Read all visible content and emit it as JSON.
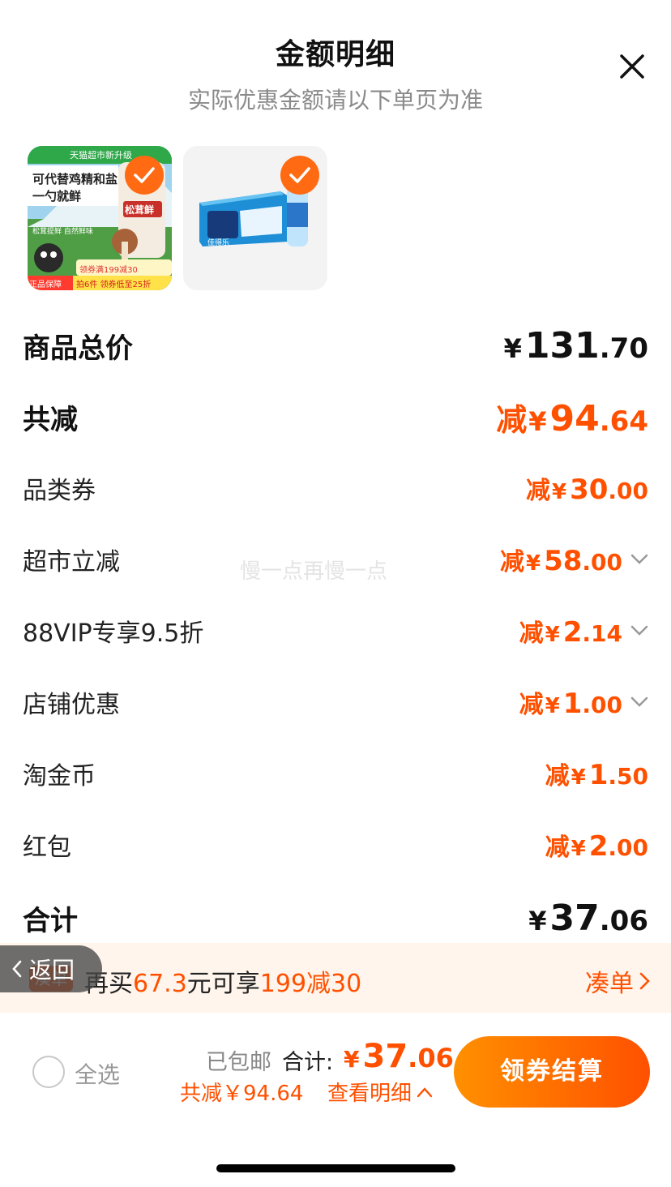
{
  "header": {
    "title": "金额明细",
    "subtitle": "实际优惠金额请以下单页为准"
  },
  "products": [
    {
      "banner": "天猫超市新升级",
      "headline": "可代替鸡精和盐",
      "subline": "一勺就鲜",
      "tagline": "松茸提鲜 自然鲜味",
      "brand": "松茸鲜",
      "coupon": "领券满199减30",
      "badge": "正品保障",
      "deal": "拍6件 领券低至25折",
      "selected": true
    },
    {
      "brand": "佳得乐",
      "selected": true
    }
  ],
  "rows": {
    "total": {
      "label": "商品总价",
      "yen": "¥",
      "int": "131",
      "dec": ".70"
    },
    "saved": {
      "label": "共减",
      "jian": "减",
      "yen": "¥",
      "int": "94",
      "dec": ".64"
    },
    "items": [
      {
        "label": "品类券",
        "jian": "减",
        "yen": "¥",
        "int": "30",
        "dec": ".00"
      },
      {
        "label": "超市立减",
        "jian": "减",
        "yen": "¥",
        "int": "58",
        "dec": ".00"
      },
      {
        "label": "88VIP专享9.5折",
        "jian": "减",
        "yen": "¥",
        "int": "2",
        "dec": ".14"
      },
      {
        "label": "店铺优惠",
        "jian": "减",
        "yen": "¥",
        "int": "1",
        "dec": ".00"
      },
      {
        "label": "淘金币",
        "jian": "减",
        "yen": "¥",
        "int": "1",
        "dec": ".50"
      },
      {
        "label": "红包",
        "jian": "减",
        "yen": "¥",
        "int": "2",
        "dec": ".00"
      }
    ],
    "sum": {
      "label": "合计",
      "yen": "¥",
      "int": "37",
      "dec": ".06"
    }
  },
  "watermark": "慢一点再慢一点",
  "promo": {
    "tag": "凑单",
    "text_a": "再买",
    "amount": "67.3",
    "text_b": "元可享",
    "deal": "199减30",
    "link": "凑单"
  },
  "back": {
    "label": "返回"
  },
  "footer": {
    "select_all": "全选",
    "free_shipping": "已包邮",
    "sum_label": "合计:",
    "sum_yen": "¥",
    "sum_int": "37",
    "sum_dec": ".06",
    "saved_text": "共减￥94.64",
    "detail_link": "查看明细",
    "checkout": "领券结算"
  },
  "colors": {
    "accent": "#ff5000",
    "accent_gradient_start": "#ff9000",
    "promo_bg": "#fff5ec"
  },
  "icons": [
    "close-icon",
    "check-icon",
    "chevron-down-icon",
    "chevron-right-icon",
    "chevron-left-icon",
    "chevron-up-icon"
  ]
}
